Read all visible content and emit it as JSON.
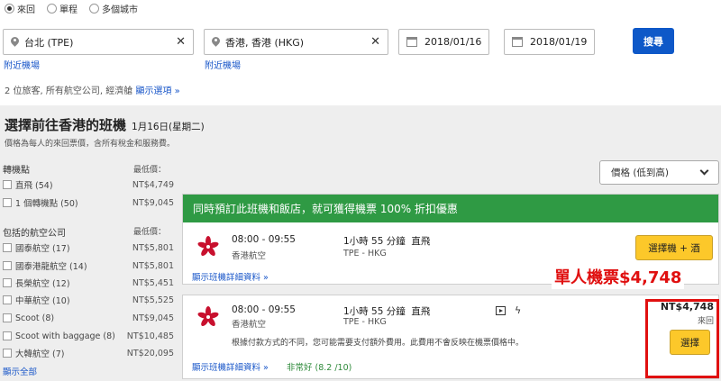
{
  "trip_type": {
    "options": [
      {
        "label": "來回",
        "checked": true
      },
      {
        "label": "單程",
        "checked": false
      },
      {
        "label": "多個城市",
        "checked": false
      }
    ]
  },
  "search": {
    "origin": "台北 (TPE)",
    "destination": "香港, 香港 (HKG)",
    "depart_date": "2018/01/16",
    "return_date": "2018/01/19",
    "nearby_label": "附近機場",
    "search_button": "搜尋",
    "pax_summary": "2 位旅客, 所有航空公司, 經濟艙",
    "show_options": "顯示選項"
  },
  "results": {
    "title": "選擇前往香港的班機",
    "date": "1月16日(星期二)",
    "subtitle": "價格為每人的來回票價，含所有稅金和服務費。",
    "sort_label": "價格 (低到高)"
  },
  "filters": {
    "lowest_price_label": "最低價：",
    "stops_heading": "轉機點",
    "stops": [
      {
        "label": "直飛 (54)",
        "price": "NT$4,749"
      },
      {
        "label": "1 個轉機點 (50)",
        "price": "NT$9,045"
      }
    ],
    "airlines_heading": "包括的航空公司",
    "airlines": [
      {
        "label": "國泰航空 (17)",
        "price": "NT$5,801"
      },
      {
        "label": "國泰港龍航空 (14)",
        "price": "NT$5,801"
      },
      {
        "label": "長榮航空 (12)",
        "price": "NT$5,451"
      },
      {
        "label": "中華航空 (10)",
        "price": "NT$5,525"
      },
      {
        "label": "Scoot (8)",
        "price": "NT$9,045"
      },
      {
        "label": "Scoot with baggage (8)",
        "price": "NT$10,485"
      },
      {
        "label": "大韓航空 (7)",
        "price": "NT$20,095"
      }
    ],
    "show_all": "顯示全部"
  },
  "flights": [
    {
      "promo": "同時預訂此班機和飯店，就可獲得機票 100% 折扣優惠",
      "time": "08:00 - 09:55",
      "airline": "香港航空",
      "duration": "1小時 55 分鐘",
      "stops": "直飛",
      "route": "TPE - HKG",
      "details": "顯示班機詳細資料",
      "button": "選擇機 + 酒"
    },
    {
      "time": "08:00 - 09:55",
      "airline": "香港航空",
      "duration": "1小時 55 分鐘",
      "stops": "直飛",
      "route": "TPE - HKG",
      "note": "根據付款方式的不同，您可能需要支付額外費用。此費用不會反映在機票價格中。",
      "details": "顯示班機詳細資料",
      "rating": "非常好 (8.2 /10)",
      "price": "NT$4,748",
      "trip": "來回",
      "button": "選擇"
    }
  ],
  "annotation": "單人機票$4,748",
  "colors": {
    "link": "#1a57c9",
    "primary_button": "#0e58c8",
    "promo_green": "#2f9a44",
    "select_yellow": "#fcc82a",
    "highlight_red": "#e01010"
  }
}
